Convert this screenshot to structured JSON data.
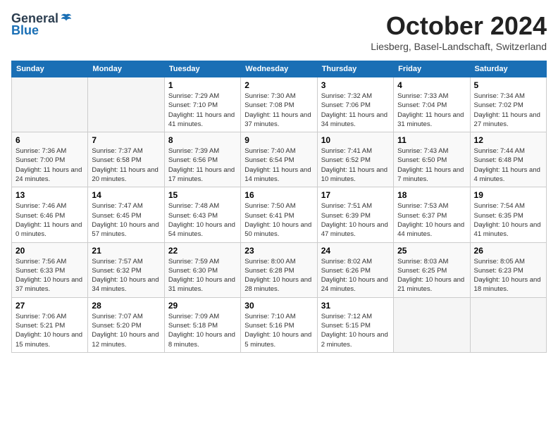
{
  "header": {
    "logo_general": "General",
    "logo_blue": "Blue",
    "month_title": "October 2024",
    "location": "Liesberg, Basel-Landschaft, Switzerland"
  },
  "days_of_week": [
    "Sunday",
    "Monday",
    "Tuesday",
    "Wednesday",
    "Thursday",
    "Friday",
    "Saturday"
  ],
  "weeks": [
    [
      {
        "day": "",
        "empty": true
      },
      {
        "day": "",
        "empty": true
      },
      {
        "day": "1",
        "sunrise": "7:29 AM",
        "sunset": "7:10 PM",
        "daylight": "11 hours and 41 minutes."
      },
      {
        "day": "2",
        "sunrise": "7:30 AM",
        "sunset": "7:08 PM",
        "daylight": "11 hours and 37 minutes."
      },
      {
        "day": "3",
        "sunrise": "7:32 AM",
        "sunset": "7:06 PM",
        "daylight": "11 hours and 34 minutes."
      },
      {
        "day": "4",
        "sunrise": "7:33 AM",
        "sunset": "7:04 PM",
        "daylight": "11 hours and 31 minutes."
      },
      {
        "day": "5",
        "sunrise": "7:34 AM",
        "sunset": "7:02 PM",
        "daylight": "11 hours and 27 minutes."
      }
    ],
    [
      {
        "day": "6",
        "sunrise": "7:36 AM",
        "sunset": "7:00 PM",
        "daylight": "11 hours and 24 minutes."
      },
      {
        "day": "7",
        "sunrise": "7:37 AM",
        "sunset": "6:58 PM",
        "daylight": "11 hours and 20 minutes."
      },
      {
        "day": "8",
        "sunrise": "7:39 AM",
        "sunset": "6:56 PM",
        "daylight": "11 hours and 17 minutes."
      },
      {
        "day": "9",
        "sunrise": "7:40 AM",
        "sunset": "6:54 PM",
        "daylight": "11 hours and 14 minutes."
      },
      {
        "day": "10",
        "sunrise": "7:41 AM",
        "sunset": "6:52 PM",
        "daylight": "11 hours and 10 minutes."
      },
      {
        "day": "11",
        "sunrise": "7:43 AM",
        "sunset": "6:50 PM",
        "daylight": "11 hours and 7 minutes."
      },
      {
        "day": "12",
        "sunrise": "7:44 AM",
        "sunset": "6:48 PM",
        "daylight": "11 hours and 4 minutes."
      }
    ],
    [
      {
        "day": "13",
        "sunrise": "7:46 AM",
        "sunset": "6:46 PM",
        "daylight": "11 hours and 0 minutes."
      },
      {
        "day": "14",
        "sunrise": "7:47 AM",
        "sunset": "6:45 PM",
        "daylight": "10 hours and 57 minutes."
      },
      {
        "day": "15",
        "sunrise": "7:48 AM",
        "sunset": "6:43 PM",
        "daylight": "10 hours and 54 minutes."
      },
      {
        "day": "16",
        "sunrise": "7:50 AM",
        "sunset": "6:41 PM",
        "daylight": "10 hours and 50 minutes."
      },
      {
        "day": "17",
        "sunrise": "7:51 AM",
        "sunset": "6:39 PM",
        "daylight": "10 hours and 47 minutes."
      },
      {
        "day": "18",
        "sunrise": "7:53 AM",
        "sunset": "6:37 PM",
        "daylight": "10 hours and 44 minutes."
      },
      {
        "day": "19",
        "sunrise": "7:54 AM",
        "sunset": "6:35 PM",
        "daylight": "10 hours and 41 minutes."
      }
    ],
    [
      {
        "day": "20",
        "sunrise": "7:56 AM",
        "sunset": "6:33 PM",
        "daylight": "10 hours and 37 minutes."
      },
      {
        "day": "21",
        "sunrise": "7:57 AM",
        "sunset": "6:32 PM",
        "daylight": "10 hours and 34 minutes."
      },
      {
        "day": "22",
        "sunrise": "7:59 AM",
        "sunset": "6:30 PM",
        "daylight": "10 hours and 31 minutes."
      },
      {
        "day": "23",
        "sunrise": "8:00 AM",
        "sunset": "6:28 PM",
        "daylight": "10 hours and 28 minutes."
      },
      {
        "day": "24",
        "sunrise": "8:02 AM",
        "sunset": "6:26 PM",
        "daylight": "10 hours and 24 minutes."
      },
      {
        "day": "25",
        "sunrise": "8:03 AM",
        "sunset": "6:25 PM",
        "daylight": "10 hours and 21 minutes."
      },
      {
        "day": "26",
        "sunrise": "8:05 AM",
        "sunset": "6:23 PM",
        "daylight": "10 hours and 18 minutes."
      }
    ],
    [
      {
        "day": "27",
        "sunrise": "7:06 AM",
        "sunset": "5:21 PM",
        "daylight": "10 hours and 15 minutes."
      },
      {
        "day": "28",
        "sunrise": "7:07 AM",
        "sunset": "5:20 PM",
        "daylight": "10 hours and 12 minutes."
      },
      {
        "day": "29",
        "sunrise": "7:09 AM",
        "sunset": "5:18 PM",
        "daylight": "10 hours and 8 minutes."
      },
      {
        "day": "30",
        "sunrise": "7:10 AM",
        "sunset": "5:16 PM",
        "daylight": "10 hours and 5 minutes."
      },
      {
        "day": "31",
        "sunrise": "7:12 AM",
        "sunset": "5:15 PM",
        "daylight": "10 hours and 2 minutes."
      },
      {
        "day": "",
        "empty": true
      },
      {
        "day": "",
        "empty": true
      }
    ]
  ]
}
